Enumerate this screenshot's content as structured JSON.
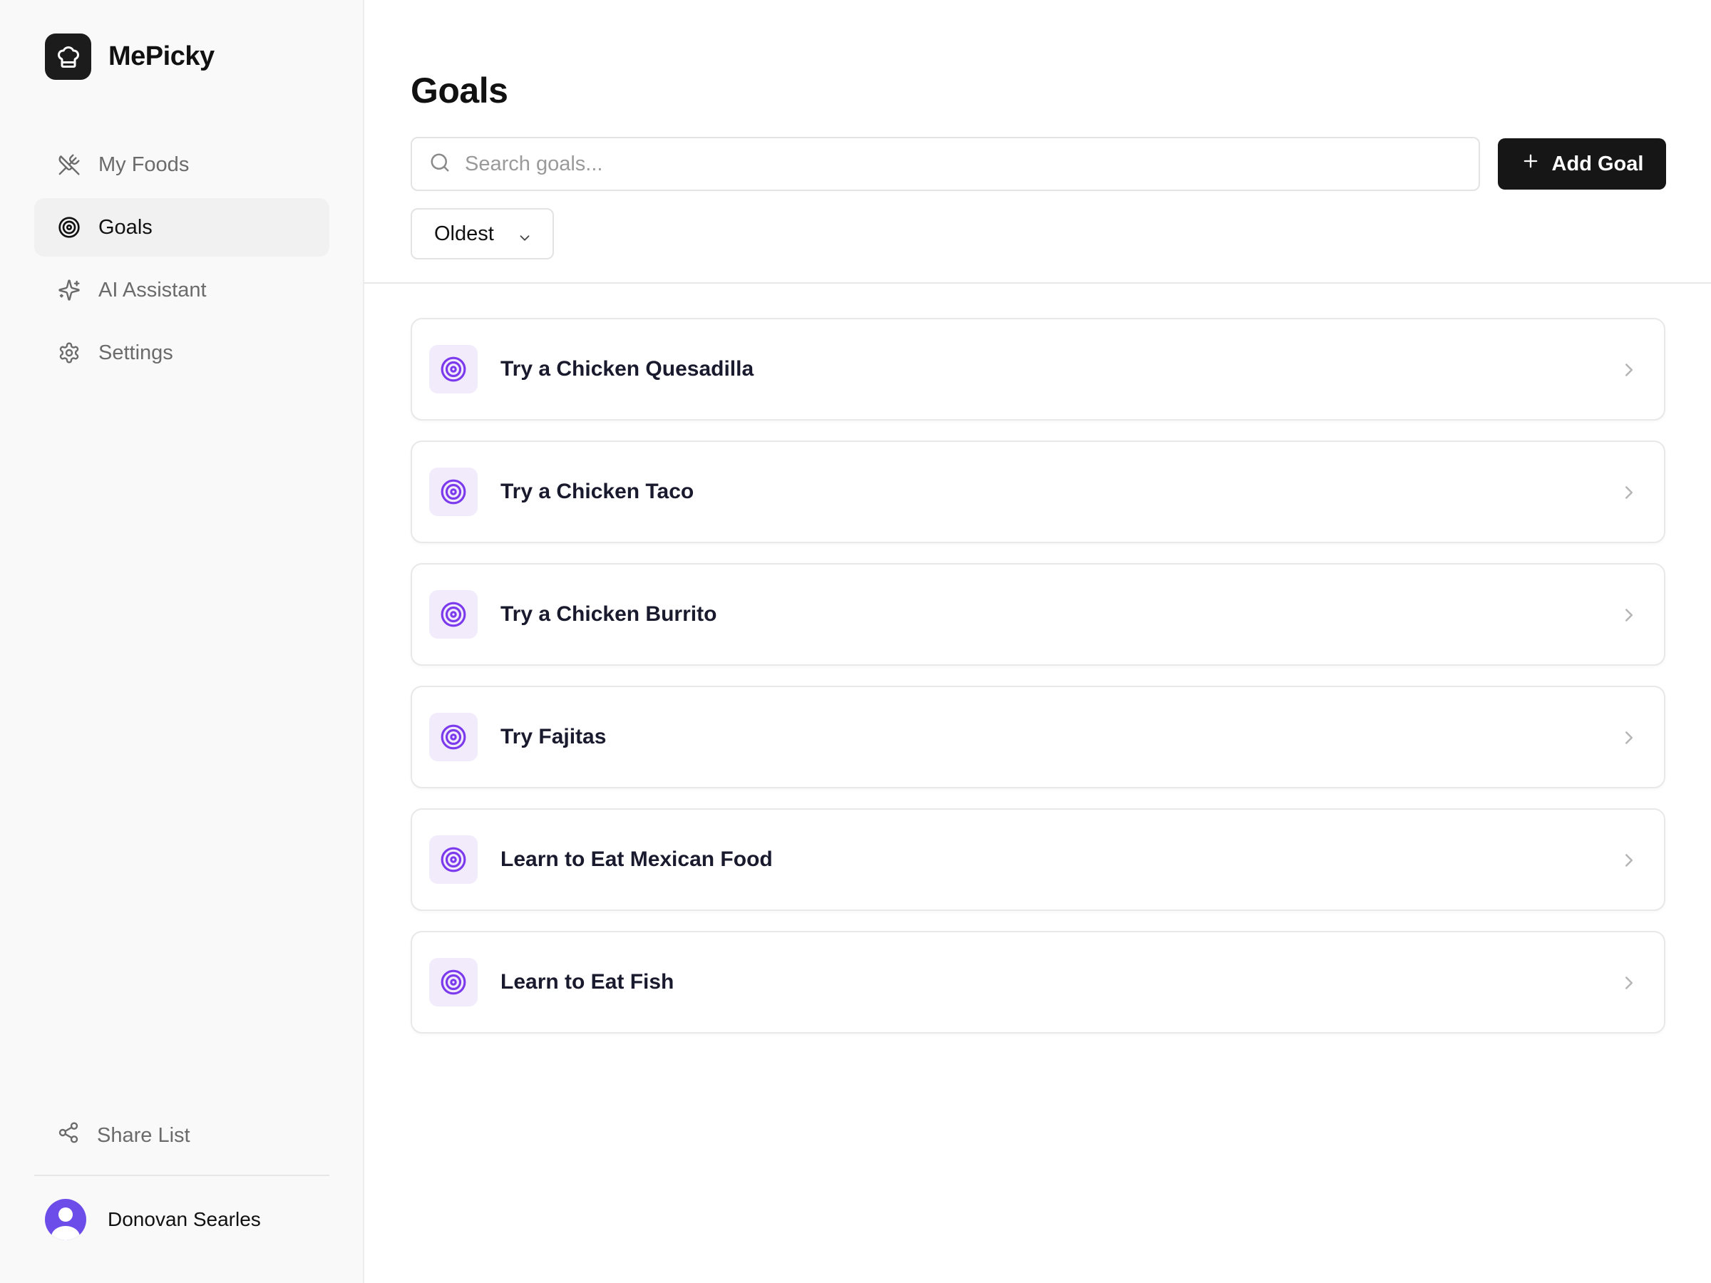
{
  "app": {
    "name": "MePicky"
  },
  "sidebar": {
    "items": [
      {
        "label": "My Foods",
        "icon": "utensils-crossed-icon",
        "active": false
      },
      {
        "label": "Goals",
        "icon": "target-icon",
        "active": true
      },
      {
        "label": "AI Assistant",
        "icon": "sparkles-icon",
        "active": false
      },
      {
        "label": "Settings",
        "icon": "gear-icon",
        "active": false
      }
    ],
    "share_label": "Share List",
    "user_name": "Donovan Searles"
  },
  "main": {
    "title": "Goals",
    "search_placeholder": "Search goals...",
    "add_button_label": "Add Goal",
    "sort_value": "Oldest",
    "goals": [
      {
        "title": "Try a Chicken Quesadilla"
      },
      {
        "title": "Try a Chicken Taco"
      },
      {
        "title": "Try a Chicken Burrito"
      },
      {
        "title": "Try Fajitas"
      },
      {
        "title": "Learn to Eat Mexican Food"
      },
      {
        "title": "Learn to Eat Fish"
      }
    ]
  },
  "colors": {
    "accent": "#7c3aed",
    "accent_bg": "#f1ebfb",
    "primary_button": "#161616",
    "avatar": "#6d4de9"
  }
}
